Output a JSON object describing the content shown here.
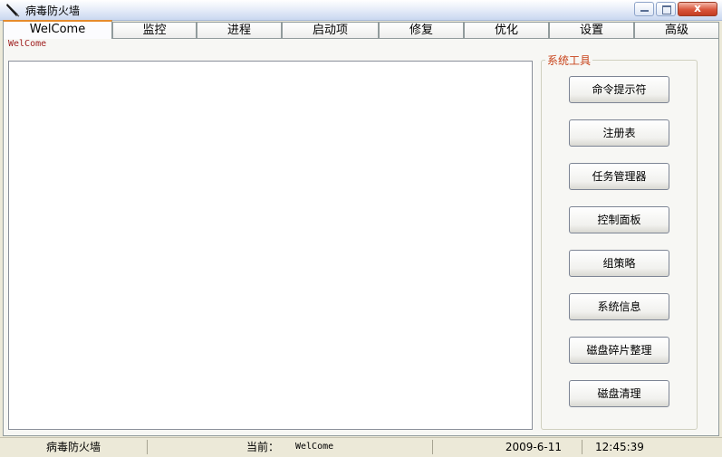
{
  "window": {
    "title": "病毒防火墙",
    "close_glyph": "x"
  },
  "tabs": [
    {
      "label": "WelCome"
    },
    {
      "label": "监控"
    },
    {
      "label": "进程"
    },
    {
      "label": "启动项"
    },
    {
      "label": "修复"
    },
    {
      "label": "优化"
    },
    {
      "label": "设置"
    },
    {
      "label": "高级"
    }
  ],
  "page": {
    "label": "WelCome"
  },
  "tools": {
    "title": "系统工具",
    "buttons": [
      {
        "label": "命令提示符"
      },
      {
        "label": "注册表"
      },
      {
        "label": "任务管理器"
      },
      {
        "label": "控制面板"
      },
      {
        "label": "组策略"
      },
      {
        "label": "系统信息"
      },
      {
        "label": "磁盘碎片整理"
      },
      {
        "label": "磁盘清理"
      }
    ]
  },
  "status": {
    "app_name": "病毒防火墙",
    "current_label": "当前：",
    "current_value": "WelCome",
    "date": "2009-6-11",
    "time": "12:45:39"
  },
  "colors": {
    "active_tab_accent": "#e68b2c",
    "group_title": "#c8431a",
    "page_label": "#a02020"
  }
}
